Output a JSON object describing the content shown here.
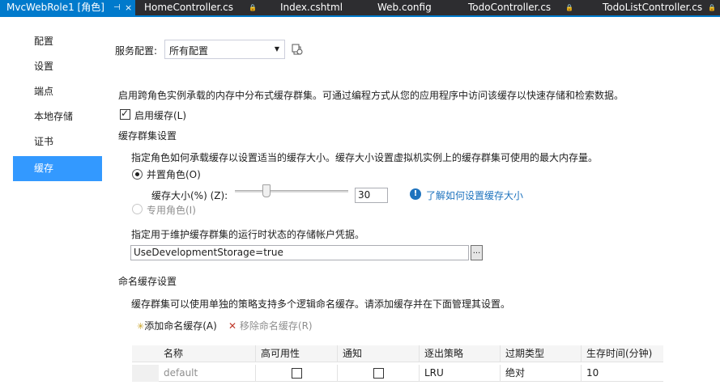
{
  "tabs": [
    {
      "label": "MvcWebRole1 [角色]",
      "pin": "⊣",
      "close": "×"
    },
    {
      "label": "HomeController.cs",
      "pin": "🔒"
    },
    {
      "label": "Index.cshtml",
      "pin": ""
    },
    {
      "label": "Web.config",
      "pin": ""
    },
    {
      "label": "TodoController.cs",
      "pin": "🔒"
    },
    {
      "label": "TodoListController.cs",
      "pin": "🔒"
    }
  ],
  "nav": {
    "items": [
      "配置",
      "设置",
      "端点",
      "本地存储",
      "证书",
      "缓存"
    ],
    "selected": "缓存"
  },
  "service_config": {
    "label": "服务配置:",
    "value": "所有配置"
  },
  "description": "启用跨角色实例承载的内存中分布式缓存群集。可通过编程方式从您的应用程序中访问该缓存以快速存储和检索数据。",
  "enable_cache_label": "启用缓存(L)",
  "cluster": {
    "title": "缓存群集设置",
    "desc": "指定角色如何承载缓存以设置适当的缓存大小。缓存大小设置虚拟机实例上的缓存群集可使用的最大内存量。",
    "colocated_label": "并置角色(O)",
    "size_label": "缓存大小(%) (Z):",
    "size_value": "30",
    "size_percent": 30,
    "help_icon": "!",
    "help_link": "了解如何设置缓存大小",
    "dedicated_label": "专用角色(I)",
    "storage_desc": "指定用于维护缓存群集的运行时状态的存储帐户凭据。",
    "storage_value": "UseDevelopmentStorage=true",
    "browse_label": "..."
  },
  "named_caches": {
    "title": "命名缓存设置",
    "desc": "缓存群集可以使用单独的策略支持多个逻辑命名缓存。请添加缓存并在下面管理其设置。",
    "add_label": "添加命名缓存(A)",
    "remove_label": "移除命名缓存(R)",
    "add_icon": "✳",
    "remove_icon": "✕",
    "columns": [
      "名称",
      "高可用性",
      "通知",
      "逐出策略",
      "过期类型",
      "生存时间(分钟)"
    ],
    "rows": [
      {
        "name": "default",
        "ha": false,
        "notify": false,
        "eviction": "LRU",
        "expiry": "绝对",
        "ttl": "10"
      }
    ]
  }
}
